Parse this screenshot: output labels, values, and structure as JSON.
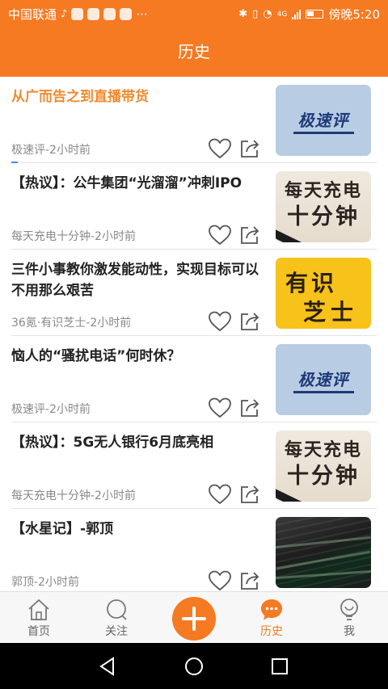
{
  "status_bar": {
    "carrier": "中国联通",
    "extra": "···",
    "network": "4G",
    "time_text": "傍晚5:20"
  },
  "header": {
    "title": "历史"
  },
  "feed": {
    "items": [
      {
        "title": "从广而告之到直播带货",
        "meta": "极速评-2小时前",
        "thumb_text": [
          "极速评"
        ],
        "highlighted": true
      },
      {
        "title": "【热议】：公牛集团“光溜溜”冲刺IPO",
        "meta": "每天充电十分钟-2小时前",
        "thumb_text": [
          "每天充电",
          "十分钟"
        ]
      },
      {
        "title": "三件小事教你激发能动性，实现目标可以不用那么艰苦",
        "meta": "36氪·有识芝士-2小时前",
        "thumb_text": [
          "有识",
          "芝士"
        ]
      },
      {
        "title": "恼人的“骚扰电话”何时休？",
        "meta": "极速评-2小时前",
        "thumb_text": [
          "极速评"
        ]
      },
      {
        "title": "【热议】：5G无人银行6月底亮相",
        "meta": "每天充电十分钟-2小时前",
        "thumb_text": [
          "每天充电",
          "十分钟"
        ]
      },
      {
        "title": "【水星记】-郭顶",
        "meta": "郭顶-2小时前",
        "thumb_text": []
      }
    ]
  },
  "tab_bar": {
    "home": "首页",
    "follow": "关注",
    "history": "历史",
    "me": "我",
    "active_tab": "history"
  },
  "colors": {
    "brand_orange": "#f57a22",
    "highlight_title": "#f08a2e",
    "meta_gray": "#888888"
  }
}
